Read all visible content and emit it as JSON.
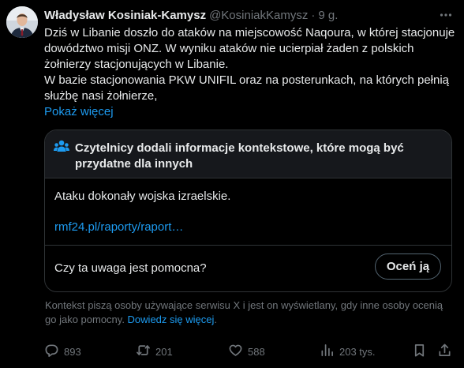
{
  "tweet": {
    "author_name": "Władysław Kosiniak-Kamysz",
    "handle": "@KosiniakKamysz",
    "separator": "·",
    "time": "9 g.",
    "text_paragraphs": [
      "Dziś w Libanie  doszło do ataków na miejscowość Naqoura, w której stacjonuje dowództwo misji ONZ. W wyniku ataków nie ucierpiał żaden z polskich żołnierzy stacjonujących w Libanie.",
      "W bazie stacjonowania PKW UNIFIL oraz na posterunkach, na których pełnią służbę nasi żołnierze,"
    ],
    "show_more": "Pokaż więcej"
  },
  "community_note": {
    "title": "Czytelnicy dodali informacje kontekstowe, które mogą być przydatne dla innych",
    "body": "Ataku dokonały wojska izraelskie.",
    "link": "rmf24.pl/raporty/raport…",
    "question": "Czy ta uwaga jest pomocna?",
    "rate_button": "Oceń ją"
  },
  "disclaimer": {
    "text": "Kontekst piszą osoby używające serwisu X i jest on wyświetlany, gdy inne osoby ocenią go jako pomocny. ",
    "link": "Dowiedz się więcej",
    "end": "."
  },
  "actions": {
    "replies": "893",
    "reposts": "201",
    "likes": "588",
    "views": "203 tys."
  },
  "colors": {
    "background": "#000000",
    "text_primary": "#e7e9ea",
    "text_secondary": "#71767b",
    "accent": "#1d9bf0",
    "border": "#2f3336",
    "note_header_bg": "#16181c"
  },
  "icons": [
    "avatar",
    "more-icon",
    "community-notes-icon",
    "reply-icon",
    "repost-icon",
    "like-icon",
    "views-icon",
    "bookmark-icon",
    "share-icon"
  ]
}
